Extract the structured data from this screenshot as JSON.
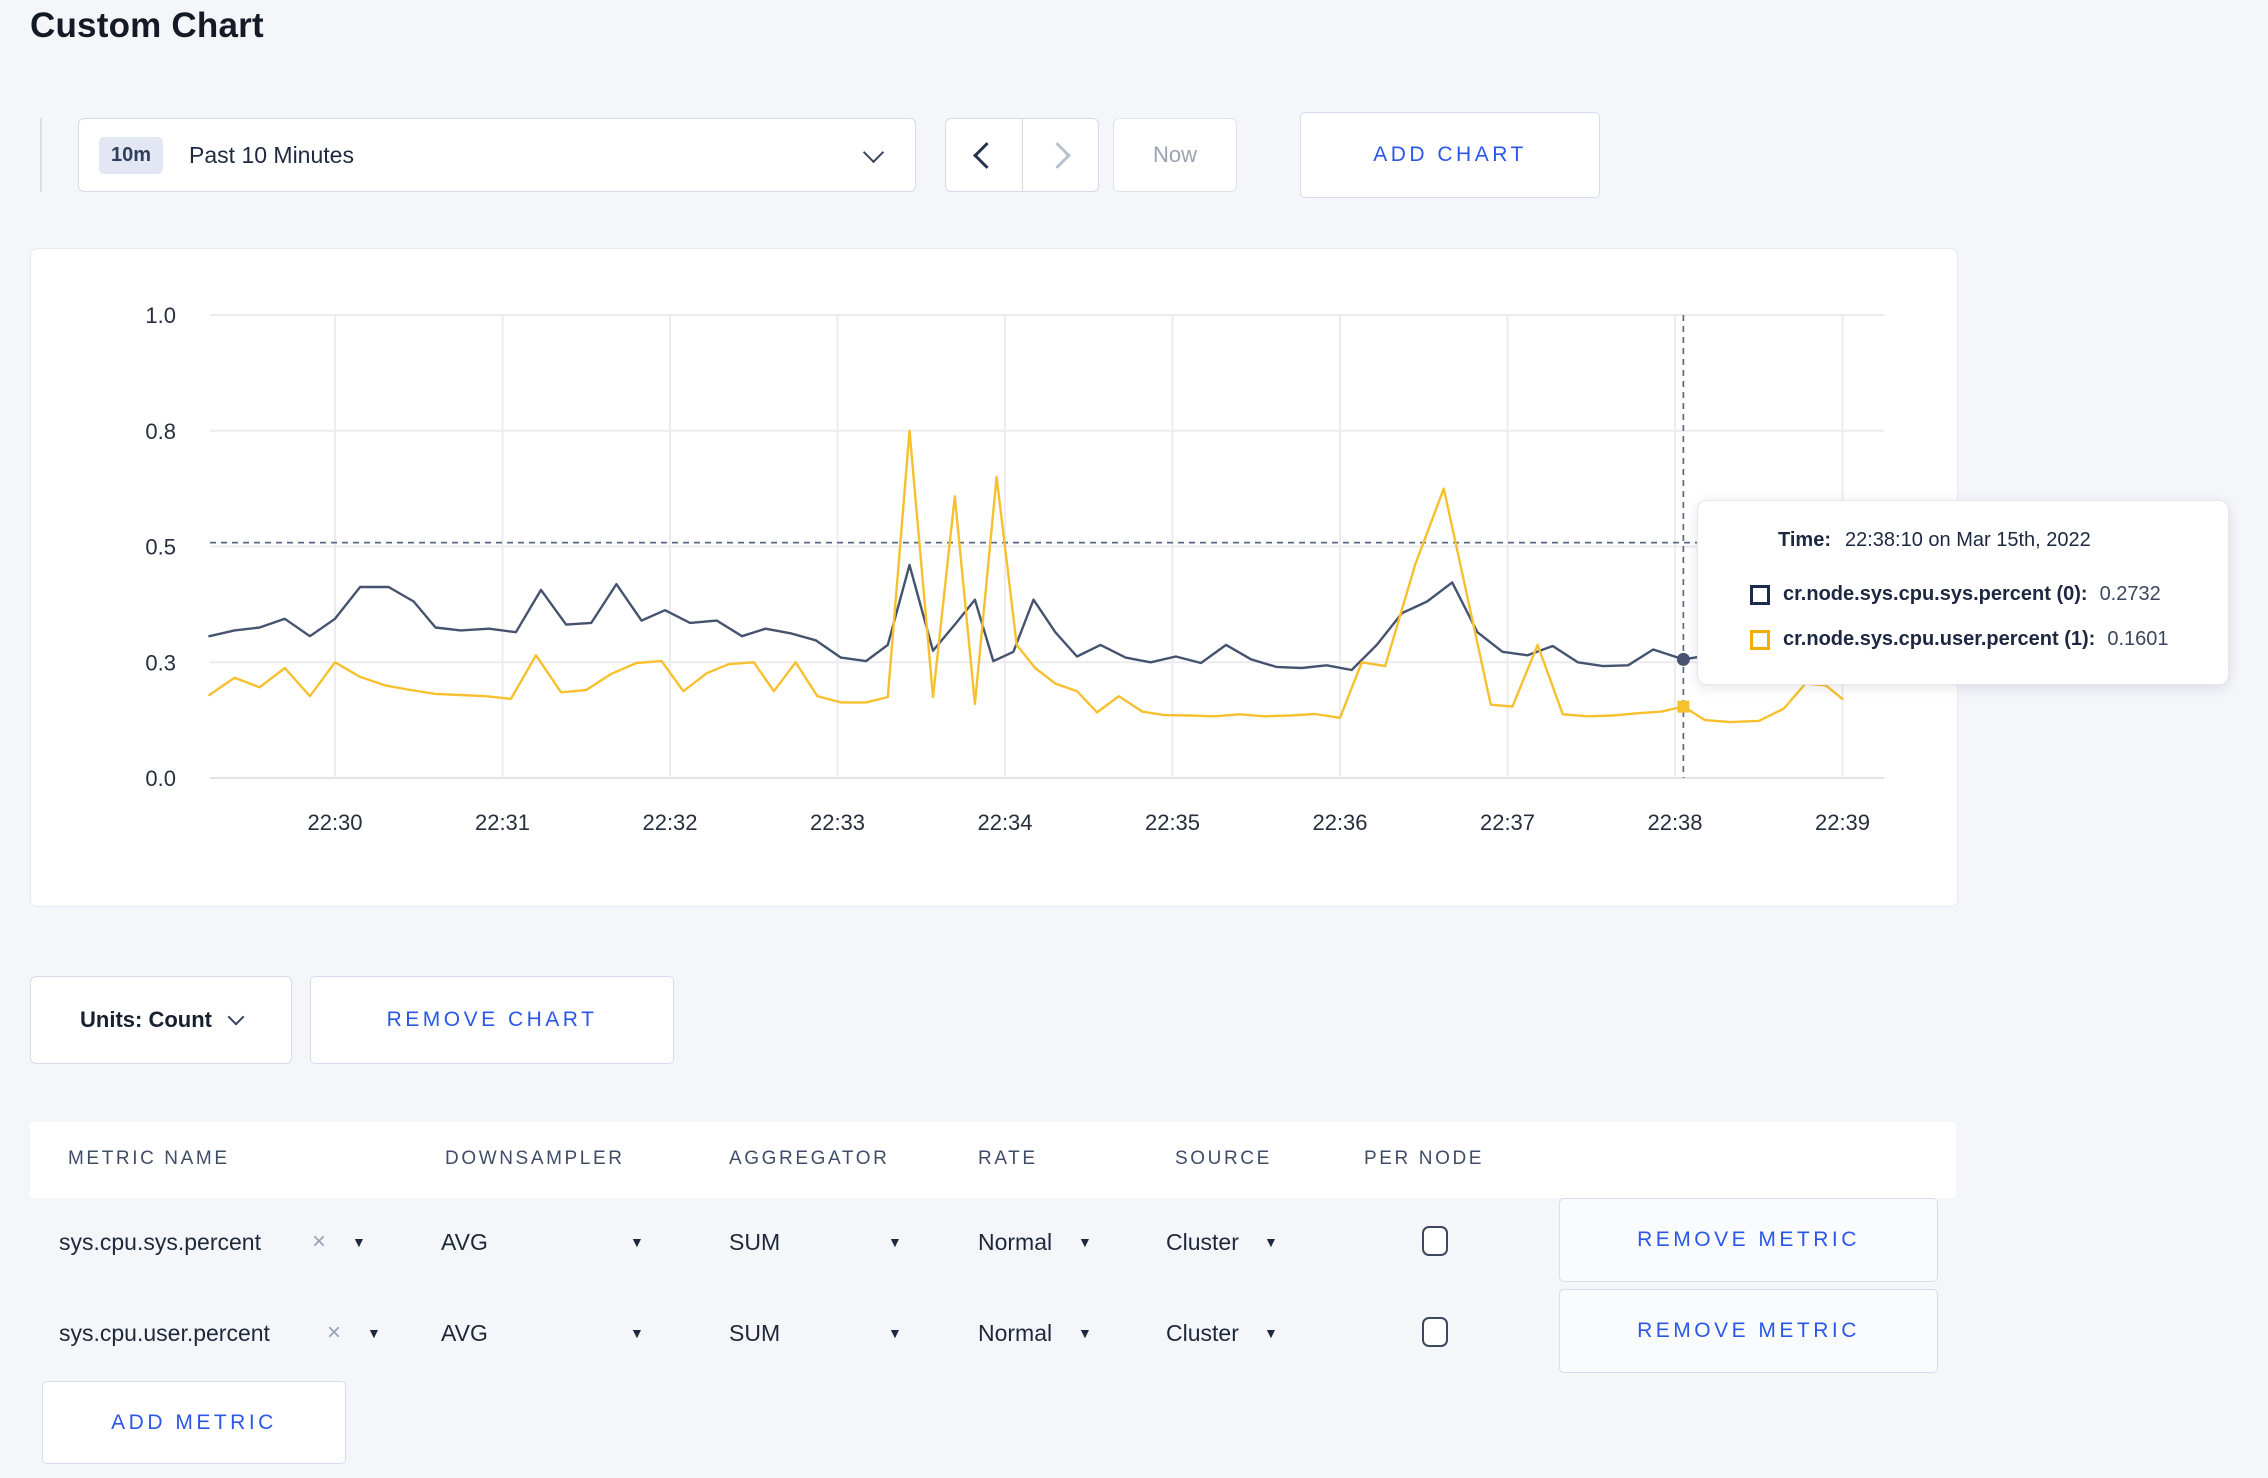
{
  "page": {
    "title": "Custom Chart"
  },
  "toolbar": {
    "range_badge": "10m",
    "range_label": "Past 10 Minutes",
    "now_label": "Now",
    "add_chart_label": "ADD CHART"
  },
  "chart_data": {
    "type": "line",
    "title": "",
    "xlabel": "",
    "ylabel": "",
    "grid": true,
    "legend_position": "tooltip",
    "x_ticks": [
      {
        "t": 0,
        "label": "22:30"
      },
      {
        "t": 1,
        "label": "22:31"
      },
      {
        "t": 2,
        "label": "22:32"
      },
      {
        "t": 3,
        "label": "22:33"
      },
      {
        "t": 4,
        "label": "22:34"
      },
      {
        "t": 5,
        "label": "22:35"
      },
      {
        "t": 6,
        "label": "22:36"
      },
      {
        "t": 7,
        "label": "22:37"
      },
      {
        "t": 8,
        "label": "22:38"
      },
      {
        "t": 9,
        "label": "22:39"
      }
    ],
    "y_ticks": [
      {
        "v": 0.0,
        "label": "0.0"
      },
      {
        "v": 0.3,
        "label": "0.3"
      },
      {
        "v": 0.5,
        "label": "0.5"
      },
      {
        "v": 0.8,
        "label": "0.8"
      },
      {
        "v": 1.0,
        "label": "1.0"
      }
    ],
    "x_domain_minutes_after_2230": [
      -0.78,
      9.25
    ],
    "series": [
      {
        "name": "cr.node.sys.cpu.sys.percent (0)",
        "color": "#46536F",
        "points": [
          [
            -0.75,
            0.345
          ],
          [
            -0.6,
            0.355
          ],
          [
            -0.45,
            0.36
          ],
          [
            -0.3,
            0.375
          ],
          [
            -0.15,
            0.345
          ],
          [
            0.0,
            0.375
          ],
          [
            0.15,
            0.43
          ],
          [
            0.32,
            0.43
          ],
          [
            0.47,
            0.405
          ],
          [
            0.6,
            0.36
          ],
          [
            0.75,
            0.355
          ],
          [
            0.92,
            0.358
          ],
          [
            1.08,
            0.352
          ],
          [
            1.23,
            0.425
          ],
          [
            1.38,
            0.365
          ],
          [
            1.53,
            0.368
          ],
          [
            1.68,
            0.435
          ],
          [
            1.83,
            0.372
          ],
          [
            1.97,
            0.39
          ],
          [
            2.12,
            0.368
          ],
          [
            2.28,
            0.372
          ],
          [
            2.43,
            0.345
          ],
          [
            2.57,
            0.358
          ],
          [
            2.72,
            0.35
          ],
          [
            2.87,
            0.338
          ],
          [
            3.02,
            0.308
          ],
          [
            3.17,
            0.302
          ],
          [
            3.3,
            0.33
          ],
          [
            3.43,
            0.468
          ],
          [
            3.57,
            0.32
          ],
          [
            3.7,
            0.365
          ],
          [
            3.82,
            0.408
          ],
          [
            3.93,
            0.302
          ],
          [
            4.05,
            0.318
          ],
          [
            4.17,
            0.408
          ],
          [
            4.3,
            0.352
          ],
          [
            4.43,
            0.31
          ],
          [
            4.57,
            0.33
          ],
          [
            4.72,
            0.308
          ],
          [
            4.87,
            0.3
          ],
          [
            5.02,
            0.31
          ],
          [
            5.17,
            0.298
          ],
          [
            5.32,
            0.33
          ],
          [
            5.47,
            0.305
          ],
          [
            5.62,
            0.288
          ],
          [
            5.77,
            0.285
          ],
          [
            5.92,
            0.292
          ],
          [
            6.07,
            0.28
          ],
          [
            6.22,
            0.33
          ],
          [
            6.37,
            0.385
          ],
          [
            6.52,
            0.405
          ],
          [
            6.67,
            0.438
          ],
          [
            6.82,
            0.352
          ],
          [
            6.97,
            0.318
          ],
          [
            7.12,
            0.312
          ],
          [
            7.27,
            0.328
          ],
          [
            7.42,
            0.3
          ],
          [
            7.57,
            0.29
          ],
          [
            7.72,
            0.292
          ],
          [
            7.87,
            0.322
          ],
          [
            8.05,
            0.305
          ],
          [
            8.2,
            0.312
          ],
          [
            8.37,
            0.296
          ],
          [
            8.55,
            0.3
          ],
          [
            8.72,
            0.308
          ],
          [
            8.88,
            0.3
          ],
          [
            9.0,
            0.305
          ]
        ]
      },
      {
        "name": "cr.node.sys.cpu.user.percent (1)",
        "color": "#F7C02E",
        "points": [
          [
            -0.75,
            0.215
          ],
          [
            -0.6,
            0.26
          ],
          [
            -0.45,
            0.235
          ],
          [
            -0.3,
            0.285
          ],
          [
            -0.15,
            0.212
          ],
          [
            0.0,
            0.3
          ],
          [
            0.15,
            0.262
          ],
          [
            0.3,
            0.24
          ],
          [
            0.45,
            0.228
          ],
          [
            0.6,
            0.218
          ],
          [
            0.75,
            0.215
          ],
          [
            0.9,
            0.212
          ],
          [
            1.05,
            0.205
          ],
          [
            1.2,
            0.312
          ],
          [
            1.35,
            0.222
          ],
          [
            1.5,
            0.228
          ],
          [
            1.65,
            0.27
          ],
          [
            1.8,
            0.298
          ],
          [
            1.95,
            0.302
          ],
          [
            2.08,
            0.225
          ],
          [
            2.22,
            0.272
          ],
          [
            2.35,
            0.295
          ],
          [
            2.5,
            0.3
          ],
          [
            2.62,
            0.225
          ],
          [
            2.75,
            0.3
          ],
          [
            2.88,
            0.212
          ],
          [
            3.02,
            0.196
          ],
          [
            3.17,
            0.196
          ],
          [
            3.3,
            0.21
          ],
          [
            3.43,
            0.8
          ],
          [
            3.57,
            0.21
          ],
          [
            3.7,
            0.63
          ],
          [
            3.82,
            0.192
          ],
          [
            3.95,
            0.68
          ],
          [
            4.07,
            0.33
          ],
          [
            4.18,
            0.285
          ],
          [
            4.3,
            0.245
          ],
          [
            4.43,
            0.225
          ],
          [
            4.55,
            0.17
          ],
          [
            4.68,
            0.212
          ],
          [
            4.82,
            0.172
          ],
          [
            4.95,
            0.163
          ],
          [
            5.1,
            0.162
          ],
          [
            5.25,
            0.16
          ],
          [
            5.4,
            0.165
          ],
          [
            5.55,
            0.16
          ],
          [
            5.7,
            0.162
          ],
          [
            5.85,
            0.166
          ],
          [
            6.0,
            0.156
          ],
          [
            6.13,
            0.3
          ],
          [
            6.27,
            0.29
          ],
          [
            6.45,
            0.47
          ],
          [
            6.62,
            0.65
          ],
          [
            6.77,
            0.4
          ],
          [
            6.9,
            0.19
          ],
          [
            7.03,
            0.185
          ],
          [
            7.18,
            0.33
          ],
          [
            7.33,
            0.165
          ],
          [
            7.48,
            0.16
          ],
          [
            7.63,
            0.162
          ],
          [
            7.78,
            0.168
          ],
          [
            7.92,
            0.172
          ],
          [
            8.05,
            0.185
          ],
          [
            8.18,
            0.15
          ],
          [
            8.33,
            0.145
          ],
          [
            8.5,
            0.148
          ],
          [
            8.65,
            0.18
          ],
          [
            8.78,
            0.245
          ],
          [
            8.9,
            0.24
          ],
          [
            9.0,
            0.205
          ]
        ]
      }
    ],
    "crosshair": {
      "t": 8.05,
      "y_value": 0.51
    },
    "hover_points": [
      {
        "series": 0,
        "t": 8.05,
        "v": 0.305,
        "shape": "circle"
      },
      {
        "series": 1,
        "t": 8.05,
        "v": 0.185,
        "shape": "square"
      }
    ]
  },
  "tooltip": {
    "time_label": "Time:",
    "time_value": "22:38:10 on Mar 15th, 2022",
    "rows": [
      {
        "label": "cr.node.sys.cpu.sys.percent (0):",
        "value": "0.2732",
        "swatch_color": "#1C2B4A"
      },
      {
        "label": "cr.node.sys.cpu.user.percent (1):",
        "value": "0.1601",
        "swatch_color": "#F0AE00"
      }
    ]
  },
  "chart_footer": {
    "units_label": "Units: Count",
    "remove_chart_label": "REMOVE CHART"
  },
  "metrics": {
    "headers": [
      "METRIC NAME",
      "DOWNSAMPLER",
      "AGGREGATOR",
      "RATE",
      "SOURCE",
      "PER NODE"
    ],
    "rows": [
      {
        "name": "sys.cpu.sys.percent",
        "downsampler": "AVG",
        "aggregator": "SUM",
        "rate": "Normal",
        "source": "Cluster",
        "per_node_checked": false,
        "remove_label": "REMOVE METRIC"
      },
      {
        "name": "sys.cpu.user.percent",
        "downsampler": "AVG",
        "aggregator": "SUM",
        "rate": "Normal",
        "source": "Cluster",
        "per_node_checked": false,
        "remove_label": "REMOVE METRIC"
      }
    ],
    "add_metric_label": "ADD METRIC",
    "clear_symbol": "×",
    "caret_symbol": "▼"
  },
  "colors": {
    "accent_blue": "#2b57e8",
    "series_sys": "#46536F",
    "series_user": "#F7C02E",
    "page_bg": "#f4f6fa",
    "gridline": "#ececef",
    "crosshair": "#5a6a84"
  }
}
